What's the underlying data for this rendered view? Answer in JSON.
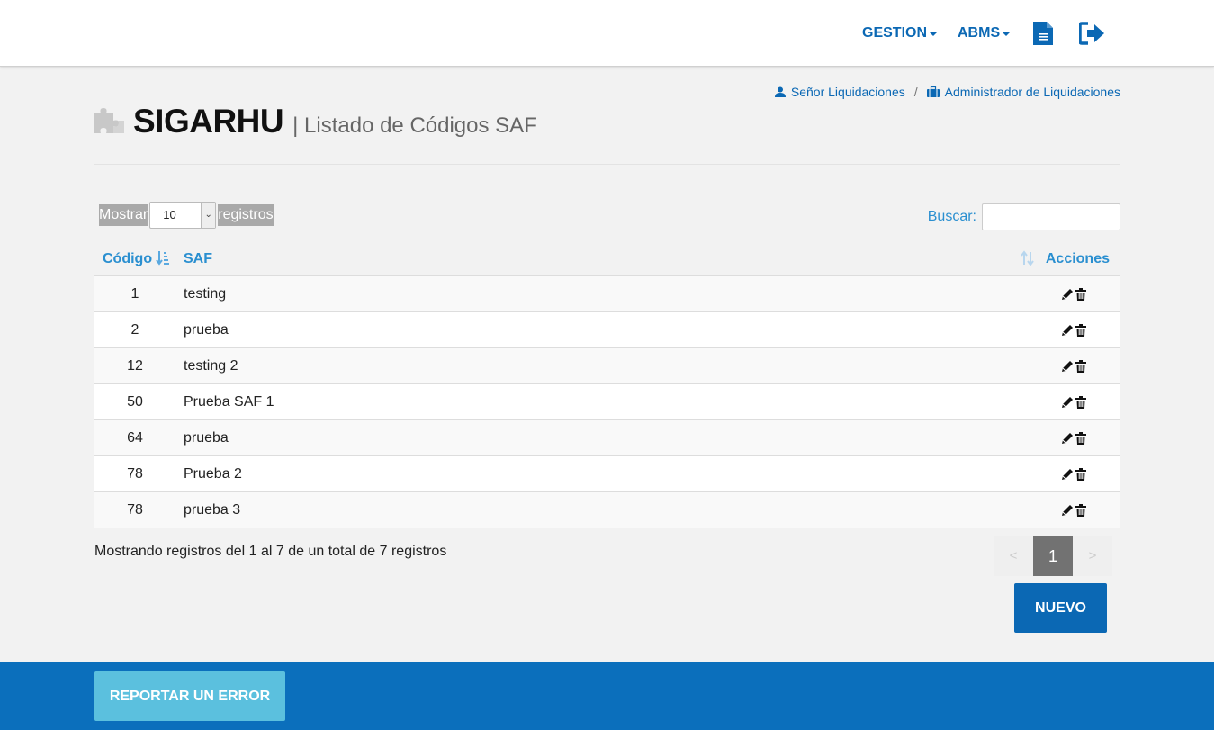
{
  "nav": {
    "gestion": "GESTION",
    "abms": "ABMS",
    "doc_icon": "document-icon",
    "exit_icon": "sign-out-icon"
  },
  "breadcrumb": {
    "user": "Señor Liquidaciones",
    "separator": "/",
    "role": "Administrador de Liquidaciones"
  },
  "header": {
    "app_name": "SIGARHU",
    "subtitle": "| Listado de Códigos SAF"
  },
  "length_menu": {
    "prefix": "Mostrar",
    "value": "10",
    "suffix": "registros"
  },
  "search": {
    "label": "Buscar:",
    "value": ""
  },
  "table": {
    "columns": [
      "Código",
      "SAF",
      "Acciones"
    ],
    "rows": [
      {
        "codigo": "1",
        "saf": "testing"
      },
      {
        "codigo": "2",
        "saf": "prueba"
      },
      {
        "codigo": "12",
        "saf": "testing 2"
      },
      {
        "codigo": "50",
        "saf": "Prueba SAF 1"
      },
      {
        "codigo": "64",
        "saf": "prueba"
      },
      {
        "codigo": "78",
        "saf": "Prueba 2"
      },
      {
        "codigo": "78",
        "saf": "prueba 3"
      }
    ]
  },
  "info": "Mostrando registros del 1 al 7 de un total de 7 registros",
  "pagination": {
    "prev": "<",
    "current": "1",
    "next": ">"
  },
  "buttons": {
    "nuevo": "NUEVO",
    "report": "REPORTAR UN ERROR"
  },
  "colors": {
    "primary": "#0b68b4",
    "link": "#2a8fd0",
    "footer": "#0b6fbc",
    "report": "#5bc0de"
  }
}
